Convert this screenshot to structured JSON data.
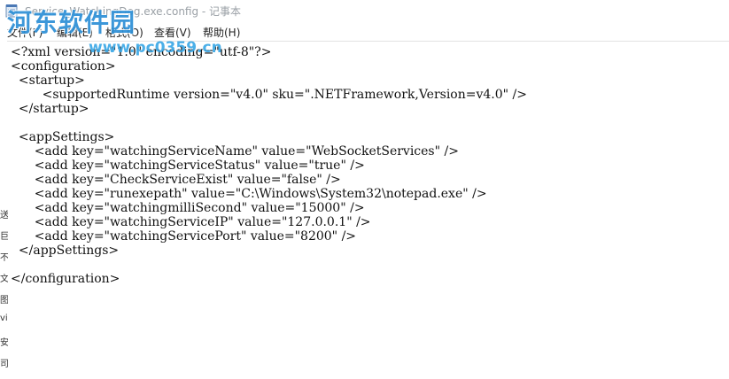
{
  "window": {
    "title": "Service_WatchingDog.exe.config - 记事本"
  },
  "menu": {
    "items": [
      "文件(F)",
      "编辑(E)",
      "格式(O)",
      "查看(V)",
      "帮助(H)"
    ]
  },
  "watermark": {
    "site_name": "河东软件园",
    "url": "www.pc0359.cn"
  },
  "editor": {
    "lines": [
      "<?xml version=\"1.0\" encoding=\"utf-8\"?>",
      "<configuration>",
      "  <startup>",
      "        <supportedRuntime version=\"v4.0\" sku=\".NETFramework,Version=v4.0\" />",
      "  </startup>",
      "",
      "  <appSettings>",
      "      <add key=\"watchingServiceName\" value=\"WebSocketServices\" />",
      "      <add key=\"watchingServiceStatus\" value=\"true\" />",
      "      <add key=\"CheckServiceExist\" value=\"false\" />",
      "      <add key=\"runexepath\" value=\"C:\\Windows\\System32\\notepad.exe\" />",
      "      <add key=\"watchingmilliSecond\" value=\"15000\" />",
      "      <add key=\"watchingServiceIP\" value=\"127.0.0.1\" />",
      "      <add key=\"watchingServicePort\" value=\"8200\" />",
      "  </appSettings>",
      "",
      "</configuration>"
    ]
  },
  "left_edge": {
    "chars": [
      "送",
      "巨",
      "不",
      "文",
      "图",
      "vi",
      "安",
      "司"
    ]
  }
}
